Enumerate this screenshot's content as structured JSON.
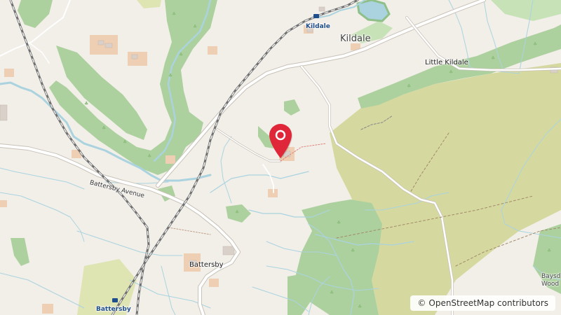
{
  "map": {
    "labels": {
      "kildale_village": "Kildale",
      "kildale_station": "Kildale",
      "little_kildale": "Little Kildale",
      "battersby_avenue": "Battersby Avenue",
      "battersby_village": "Battersby",
      "battersby_station": "Battersby",
      "baysdale_line1": "Baysd",
      "baysdale_line2": "Wood"
    },
    "attribution": {
      "symbol": "©",
      "text": "OpenStreetMap contributors"
    },
    "marker": {
      "icon": "location-pin-icon",
      "color": "#e0273a"
    },
    "colors": {
      "land": "#f2efe9",
      "wood": "#add19e",
      "heath": "#d6d99f",
      "water": "#aad3df",
      "railway": "#707070",
      "road": "#ffffff",
      "building": "#d9d0c9",
      "farmyard": "#eecfb3"
    }
  }
}
